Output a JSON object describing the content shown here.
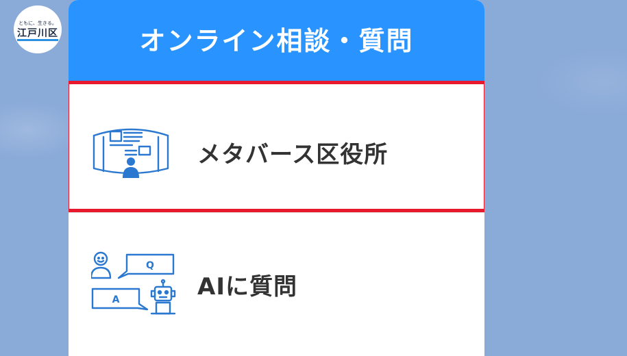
{
  "logo": {
    "tagline": "ともに、生きる。",
    "name": "江戸川区"
  },
  "panel": {
    "title": "オンライン相談・質問",
    "items": [
      {
        "label": "メタバース区役所",
        "icon": "metaverse-booth-icon",
        "selected": true
      },
      {
        "label": "AIに質問",
        "icon": "ai-chat-icon",
        "selected": false
      }
    ]
  },
  "colors": {
    "background": "#8aaad8",
    "header": "#2993ff",
    "highlight": "#e8192c",
    "icon": "#2a78d0",
    "text": "#333333"
  }
}
